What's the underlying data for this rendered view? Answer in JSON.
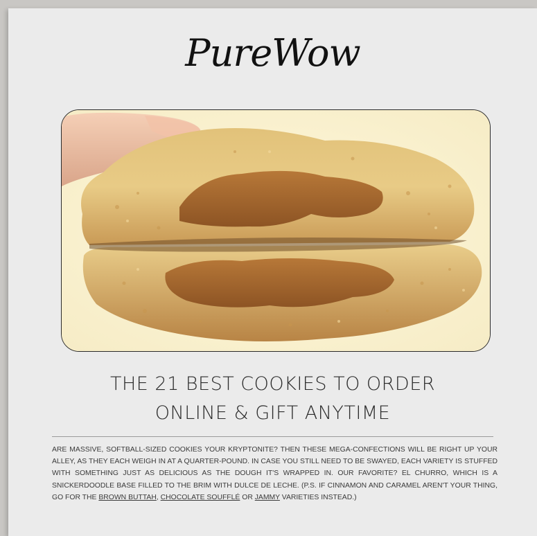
{
  "brand": {
    "logo_text": "PureWow"
  },
  "hero_image": {
    "alt": "cookie filled with dulce de leche",
    "icon": "cookie-photo"
  },
  "article": {
    "headline_line1": "THE 21 BEST COOKIES TO ORDER",
    "headline_line2": "ONLINE & GIFT ANYTIME",
    "body_intro": "ARE MASSIVE, SOFTBALL-SIZED COOKIES YOUR KRYPTONITE? THEN THESE MEGA-CONFECTIONS WILL BE RIGHT UP YOUR ALLEY, AS THEY EACH WEIGH IN AT A QUARTER-POUND. IN CASE YOU STILL NEED TO BE SWAYED, EACH VARIETY IS STUFFED WITH SOMETHING JUST AS DELICIOUS AS THE DOUGH IT'S WRAPPED IN. OUR FAVORITE? EL CHURRO, WHICH IS A SNICKERDOODLE BASE FILLED TO THE BRIM WITH DULCE DE LECHE. (P.S. IF CINNAMON AND CARAMEL AREN'T YOUR THING, GO FOR THE ",
    "link_brown_buttah": "BROWN BUTTAH",
    "sep1": ", ",
    "link_chocolate_souffle": "CHOCOLATE SOUFFLÉ",
    "sep2": " OR ",
    "link_jammy": "JAMMY",
    "body_outro": " VARIETIES INSTEAD.)"
  },
  "colors": {
    "background": "#ebebeb",
    "text": "#3a3a3a",
    "headline": "#2b2b2b"
  }
}
